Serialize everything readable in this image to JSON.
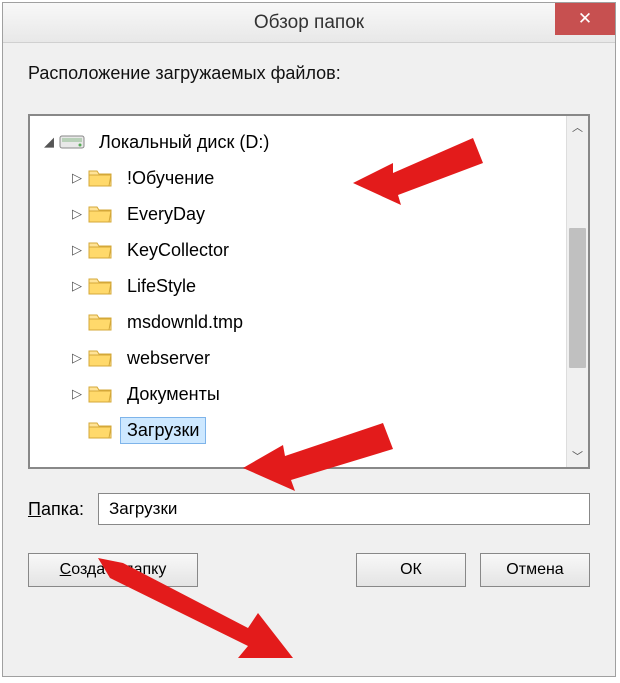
{
  "titlebar": {
    "title": "Обзор папок",
    "close_symbol": "✕"
  },
  "heading": "Расположение загружаемых файлов:",
  "tree": {
    "root": {
      "label": "Локальный диск (D:)",
      "expanded": true
    },
    "children": [
      {
        "label": "!Обучение",
        "has_children": true
      },
      {
        "label": "EveryDay",
        "has_children": true
      },
      {
        "label": "KeyCollector",
        "has_children": true
      },
      {
        "label": "LifeStyle",
        "has_children": true
      },
      {
        "label": "msdownld.tmp",
        "has_children": false
      },
      {
        "label": "webserver",
        "has_children": true
      },
      {
        "label": "Документы",
        "has_children": true
      },
      {
        "label": "Загрузки",
        "has_children": false,
        "selected": true
      }
    ]
  },
  "folder_field": {
    "label": "Папка:",
    "value": "Загрузки"
  },
  "buttons": {
    "create": "Создать папку",
    "ok": "ОК",
    "cancel": "Отмена"
  }
}
